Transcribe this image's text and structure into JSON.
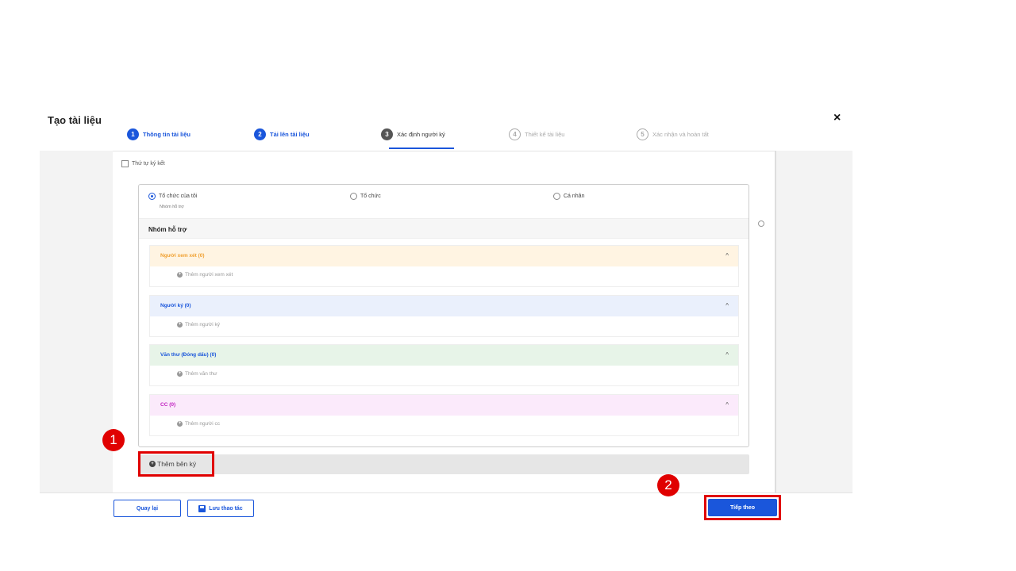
{
  "modal": {
    "title": "Tạo tài liệu",
    "close_symbol": "×"
  },
  "steps": [
    {
      "num": "1",
      "label": "Thông tin tài liệu",
      "state": "done"
    },
    {
      "num": "2",
      "label": "Tải lên tài liệu",
      "state": "done"
    },
    {
      "num": "3",
      "label": "Xác định người ký",
      "state": "active"
    },
    {
      "num": "4",
      "label": "Thiết kế tài liệu",
      "state": "todo"
    },
    {
      "num": "5",
      "label": "Xác nhận và hoàn tất",
      "state": "todo"
    }
  ],
  "signing_order_label": "Thứ tự ký kết",
  "party": {
    "options": [
      "Tổ chức của tôi",
      "Tổ chức",
      "Cá nhân"
    ],
    "selected": "Tổ chức của tôi",
    "selected_sub": "Nhóm hỗ trợ",
    "group_title": "Nhóm hỗ trợ",
    "sections": [
      {
        "label": "Người xem xét (0)",
        "add": "Thêm người xem xét",
        "color": "#f0a030",
        "bg": "#fff4e2"
      },
      {
        "label": "Người ký (0)",
        "add": "Thêm người ký",
        "color": "#1a56db",
        "bg": "#eaf0fc"
      },
      {
        "label": "Văn thư (Đóng dấu) (0)",
        "add": "Thêm văn thư",
        "color": "#1a56db",
        "bg": "#e7f4e8"
      },
      {
        "label": "CC (0)",
        "add": "Thêm người cc",
        "color": "#c020c0",
        "bg": "#fbeafb"
      }
    ]
  },
  "add_party_label": "Thêm bên ký",
  "footer": {
    "back": "Quay lại",
    "save": "Lưu thao tác",
    "next": "Tiếp theo"
  },
  "callouts": [
    "1",
    "2"
  ],
  "colors": {
    "accent": "#1a56db",
    "highlight": "#e00000"
  }
}
